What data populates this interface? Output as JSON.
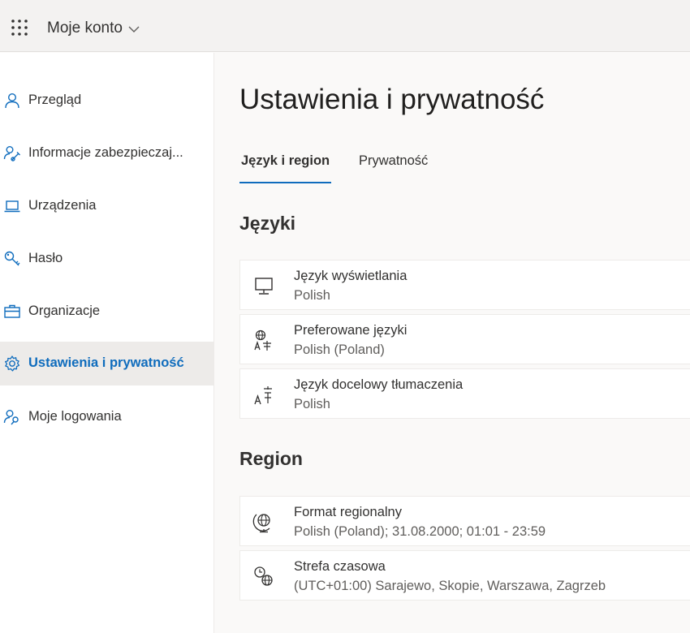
{
  "header": {
    "app_name": "Moje konto"
  },
  "sidebar": {
    "items": [
      {
        "label": "Przegląd",
        "icon": "person-icon"
      },
      {
        "label": "Informacje zabezpieczaj...",
        "icon": "person-key-icon"
      },
      {
        "label": "Urządzenia",
        "icon": "laptop-icon"
      },
      {
        "label": "Hasło",
        "icon": "key-icon"
      },
      {
        "label": "Organizacje",
        "icon": "briefcase-icon"
      },
      {
        "label": "Ustawienia i prywatność",
        "icon": "gear-icon",
        "active": true
      },
      {
        "label": "Moje logowania",
        "icon": "person-key-icon"
      }
    ]
  },
  "main": {
    "title": "Ustawienia i prywatność",
    "tabs": [
      {
        "label": "Język i region",
        "active": true
      },
      {
        "label": "Prywatność",
        "active": false
      }
    ],
    "sections": [
      {
        "title": "Języki",
        "items": [
          {
            "title": "Język wyświetlania",
            "value": "Polish",
            "icon": "monitor-icon"
          },
          {
            "title": "Preferowane języki",
            "value": "Polish (Poland)",
            "icon": "globe-language-icon"
          },
          {
            "title": "Język docelowy tłumaczenia",
            "value": "Polish",
            "icon": "translate-icon"
          }
        ]
      },
      {
        "title": "Region",
        "items": [
          {
            "title": "Format regionalny",
            "value": "Polish (Poland); 31.08.2000; 01:01 - 23:59",
            "icon": "globe-stand-icon"
          },
          {
            "title": "Strefa czasowa",
            "value": "(UTC+01:00) Sarajewo, Skopie, Warszawa, Zagrzeb",
            "icon": "clock-globe-icon"
          }
        ]
      }
    ]
  },
  "colors": {
    "accent": "#0f6cbd",
    "active_nav_bg": "#edebe9",
    "header_bg": "#f3f2f1"
  }
}
